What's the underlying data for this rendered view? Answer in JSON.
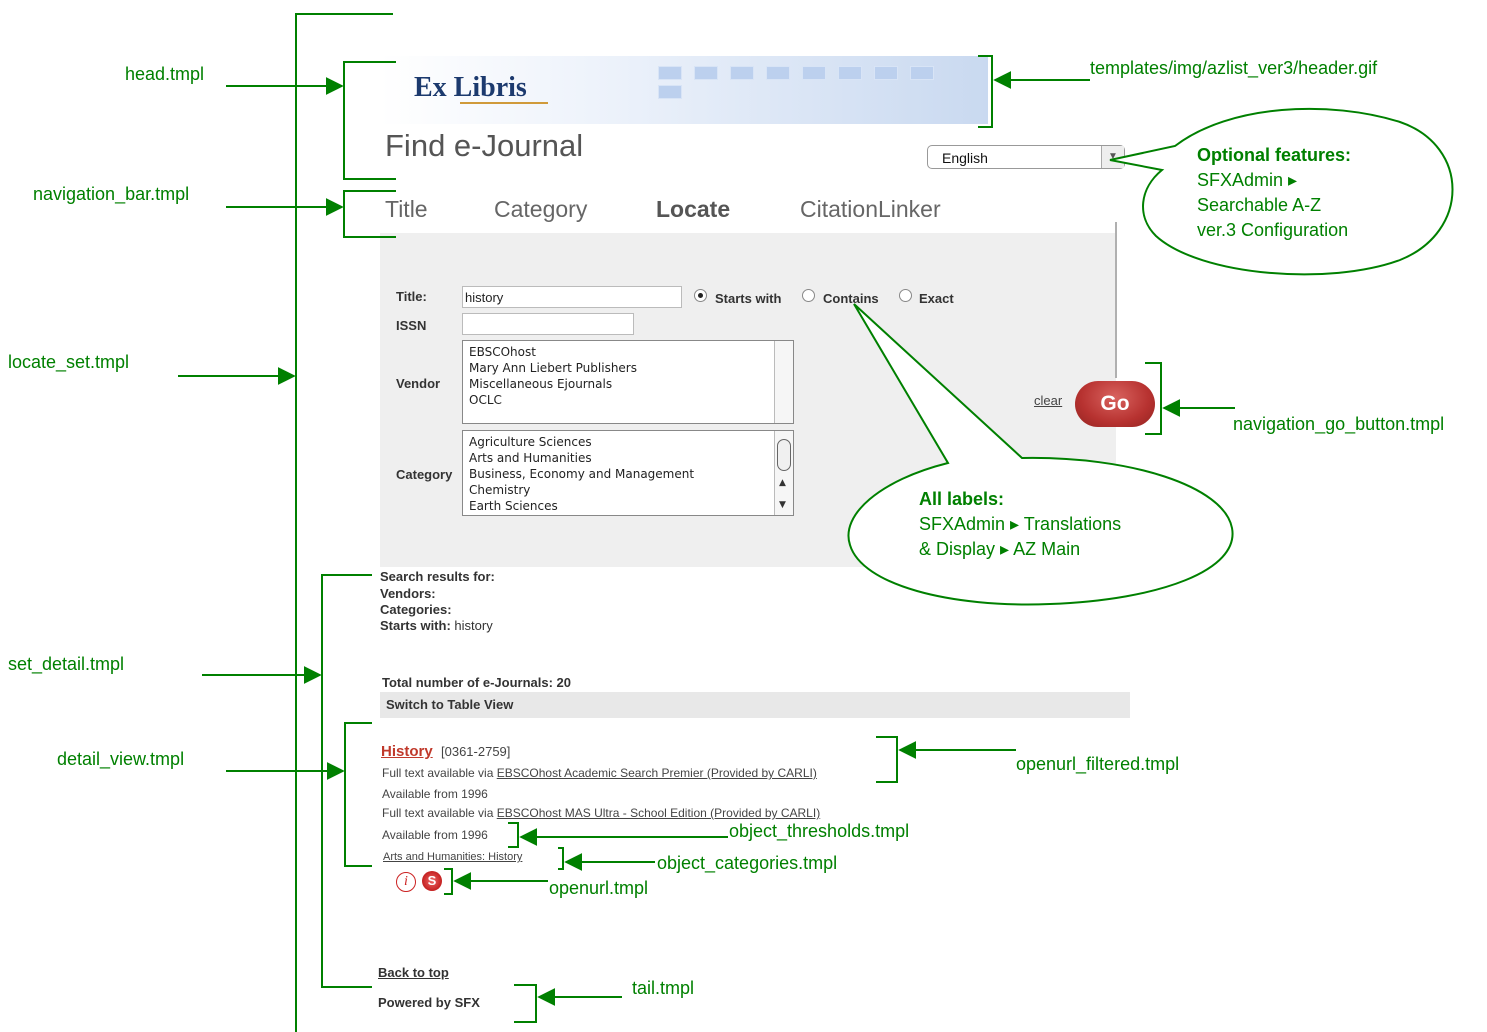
{
  "header": {
    "logo_text": "Ex Libris",
    "page_title": "Find e-Journal",
    "language": "English"
  },
  "tabs": [
    "Title",
    "Category",
    "Locate",
    "CitationLinker"
  ],
  "form": {
    "title_label": "Title:",
    "title_value": "history",
    "radio_options": [
      "Starts with",
      "Contains",
      "Exact"
    ],
    "issn_label": "ISSN",
    "vendor_label": "Vendor",
    "vendors": [
      "EBSCOhost",
      "Mary Ann Liebert Publishers",
      "Miscellaneous Ejournals",
      "OCLC"
    ],
    "category_label": "Category",
    "categories": [
      "Agriculture Sciences",
      "Arts and Humanities",
      "Business, Economy and Management",
      "Chemistry",
      "Earth Sciences"
    ],
    "clear_label": "clear",
    "go_label": "Go"
  },
  "results": {
    "search_results_for": "Search results for:",
    "vendors_label": "Vendors:",
    "categories_label": "Categories:",
    "starts_with_label": "Starts with:",
    "starts_with_value": "history",
    "total_label": "Total number of e-Journals: 20",
    "switch_label": "Switch to Table View",
    "journal_title": "History",
    "journal_issn": "[0361-2759]",
    "fulltext_prefix": "Full text available via",
    "provider1": "EBSCOhost Academic Search Premier (Provided by CARLI)",
    "available1": "Available from 1996",
    "provider2": "EBSCOhost MAS Ultra - School Edition (Provided by CARLI)",
    "available2": "Available from 1996",
    "category_link": "Arts and Humanities: History"
  },
  "tail": {
    "back_to_top": "Back to top",
    "powered_by": "Powered by SFX"
  },
  "annotations": {
    "head": "head.tmpl",
    "navigation_bar": "navigation_bar.tmpl",
    "locate_set": "locate_set.tmpl",
    "set_detail": "set_detail.tmpl",
    "detail_view": "detail_view.tmpl",
    "header_gif": "templates/img/azlist_ver3/header.gif",
    "go_button": "navigation_go_button.tmpl",
    "openurl_filtered": "openurl_filtered.tmpl",
    "object_thresholds": "object_thresholds.tmpl",
    "object_categories": "object_categories.tmpl",
    "openurl": "openurl.tmpl",
    "tail": "tail.tmpl"
  },
  "bubbles": {
    "optional_title": "Optional features:",
    "optional_line1": "SFXAdmin ▸",
    "optional_line2": "Searchable A-Z",
    "optional_line3": "ver.3 Configuration",
    "labels_title": "All labels:",
    "labels_line1": "SFXAdmin ▸ Translations",
    "labels_line2": "& Display ▸ AZ Main"
  },
  "colors": {
    "annotation": "#008000",
    "go_button": "#b73230",
    "journal_link": "#c0392b",
    "panel": "#efefef"
  }
}
